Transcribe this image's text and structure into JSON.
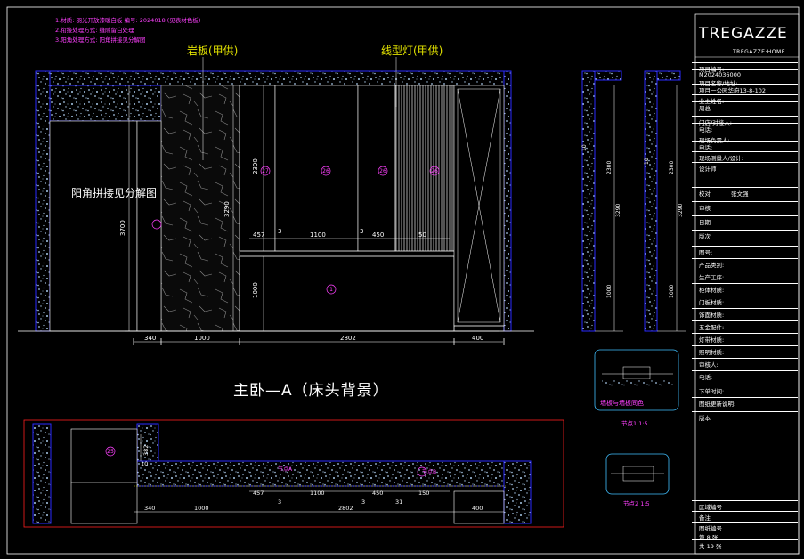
{
  "notes": [
    "1.材质: 羽光开放漆暖白板  编号: 2024018  (见表材色板)",
    "2.衔接处理方式: 缝隙留白处理",
    "3.阳角处理方式: 阳角拼接见分解图"
  ],
  "callouts": {
    "rock_slab": "岩板(甲供)",
    "line_light": "线型灯(甲供)",
    "corner_note": "阳角拼接见分解图"
  },
  "drawing_title": "主卧—A（床头背景）",
  "elevation_dims": {
    "bottom": [
      "340",
      "1000",
      "2802",
      "400"
    ],
    "middle": [
      "457",
      "3",
      "1100",
      "3",
      "450",
      "50"
    ],
    "vertical_left": "3700",
    "vertical_mid": [
      "2300",
      "1000",
      "3290"
    ],
    "side_a": [
      "10",
      "15",
      "2300",
      "3290",
      "1000",
      "15",
      "10"
    ],
    "side_b": [
      "10",
      "2300",
      "3290",
      "1000",
      "15",
      "10"
    ]
  },
  "panel_tags": [
    "27",
    "26",
    "26",
    "26",
    "1"
  ],
  "plan_dims": {
    "bottom": [
      "340",
      "1000",
      "3",
      "2802",
      "3",
      "31",
      "400"
    ],
    "middle": [
      "457",
      "1100",
      "450",
      "150"
    ],
    "vertical": [
      "10",
      "382"
    ]
  },
  "plan_tags": [
    "25",
    "节点A",
    "节点B"
  ],
  "details": [
    {
      "caption": "墙板与墙板同色",
      "scale": "节点1  1:5"
    },
    {
      "caption": "",
      "scale": "节点2  1:5"
    }
  ],
  "title_block": {
    "logo": "TREGAZZE",
    "logo_sub": "TREGAZZE·HOME",
    "rows": [
      "项目编号:",
      "M2024036000",
      "项目名称/地址:",
      "项目一公园华府13-8-102",
      "业主姓名:",
      "周总",
      "门店/对接人:",
      "电话:",
      "现场负责人:",
      "电话:",
      "现场测量人/设计:",
      "设计师",
      "校对",
      "审核",
      "日期",
      "版次",
      "图号:",
      "产品类别:",
      "生产工序:",
      "柜体材质:",
      "门板材质:",
      "饰面材质:",
      "五金配件:",
      "灯带材质:",
      "照明材质:",
      "审核人:",
      "电话:",
      "下单时间:",
      "图纸更新说明:",
      "版本",
      "区域编号",
      "备注",
      "图纸编号",
      "第 8 张",
      "共 19 张"
    ],
    "designer": "张文强",
    "sheet": "第 8 张",
    "total": "共 19 张"
  },
  "colors": {
    "frame": "#ffffff",
    "speckle": "#a8c8e8",
    "dim": "#ffffff",
    "accent": "#ff40ff",
    "wall_edge": "#2a2aff",
    "plan_border": "#ff2020",
    "detail_border": "#40c0ff",
    "callout": "#e0e000"
  }
}
